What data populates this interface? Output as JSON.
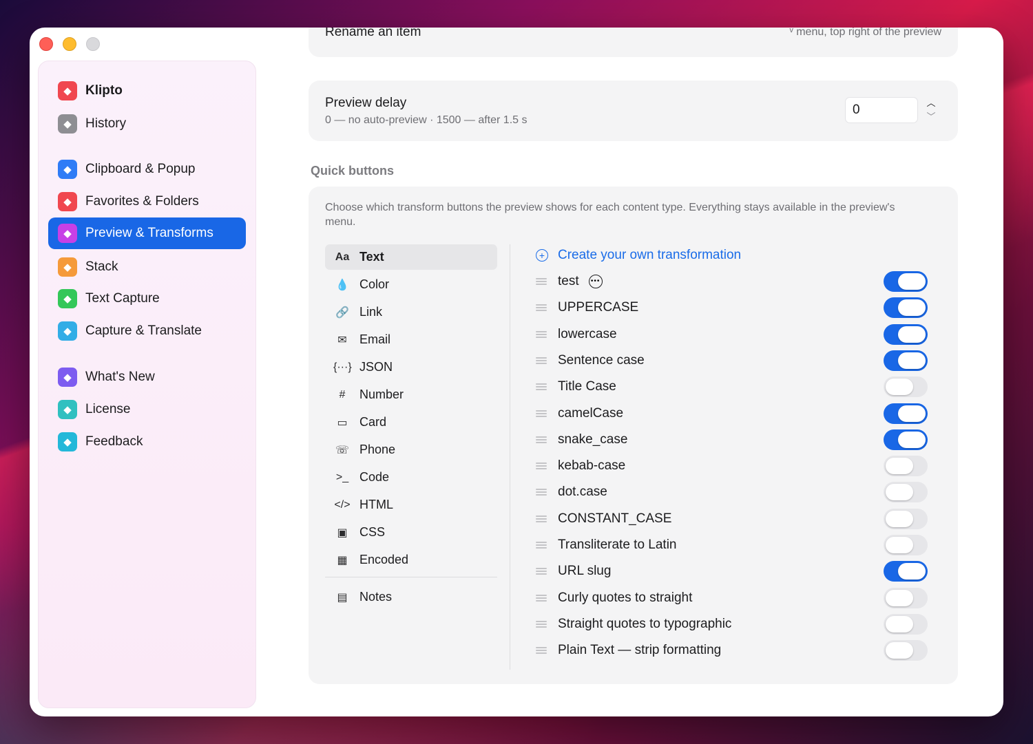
{
  "sidebar": {
    "items": [
      {
        "label": "Klipto",
        "icon": "cat-icon",
        "color": "#f0474f",
        "bold": true
      },
      {
        "label": "History",
        "icon": "clock-icon",
        "color": "#8e8e93"
      },
      {
        "label": "Clipboard & Popup",
        "icon": "clipboard-icon",
        "color": "#2f7cf6"
      },
      {
        "label": "Favorites & Folders",
        "icon": "heart-icon",
        "color": "#f0474f"
      },
      {
        "label": "Preview & Transforms",
        "icon": "preview-icon",
        "color": "#c740e6",
        "active": true
      },
      {
        "label": "Stack",
        "icon": "stack-icon",
        "color": "#f59a3a"
      },
      {
        "label": "Text Capture",
        "icon": "text-scan-icon",
        "color": "#34c759"
      },
      {
        "label": "Capture & Translate",
        "icon": "translate-icon",
        "color": "#32ade6"
      },
      {
        "label": "What's New",
        "icon": "sparkle-icon",
        "color": "#7d5cf0"
      },
      {
        "label": "License",
        "icon": "badge-check-icon",
        "color": "#30c0c0"
      },
      {
        "label": "Feedback",
        "icon": "paper-plane-icon",
        "color": "#23b8d9"
      }
    ]
  },
  "rename": {
    "title": "Rename an item",
    "note": "ᵛ menu, top right of the preview"
  },
  "delay": {
    "title": "Preview delay",
    "subtitle": "0 — no auto-preview · 1500 — after 1.5 s",
    "value": "0"
  },
  "quick": {
    "section_label": "Quick buttons",
    "description": "Choose which transform buttons the preview shows for each content type. Everything stays available in the preview's menu.",
    "types": [
      {
        "label": "Text",
        "glyph": "Aa",
        "icon": "text-icon",
        "selected": true
      },
      {
        "label": "Color",
        "glyph": "💧",
        "icon": "drop-icon"
      },
      {
        "label": "Link",
        "glyph": "🔗",
        "icon": "link-icon"
      },
      {
        "label": "Email",
        "glyph": "✉",
        "icon": "envelope-icon"
      },
      {
        "label": "JSON",
        "glyph": "{···}",
        "icon": "braces-icon"
      },
      {
        "label": "Number",
        "glyph": "#",
        "icon": "hash-icon"
      },
      {
        "label": "Card",
        "glyph": "▭",
        "icon": "credit-card-icon"
      },
      {
        "label": "Phone",
        "glyph": "☏",
        "icon": "phone-icon"
      },
      {
        "label": "Code",
        "glyph": ">_",
        "icon": "terminal-icon"
      },
      {
        "label": "HTML",
        "glyph": "</>",
        "icon": "angle-brackets-icon"
      },
      {
        "label": "CSS",
        "glyph": "▣",
        "icon": "css-icon"
      },
      {
        "label": "Encoded",
        "glyph": "▦",
        "icon": "qr-code-icon"
      }
    ],
    "notes": {
      "label": "Notes",
      "glyph": "▤",
      "icon": "document-icon"
    },
    "create_label": "Create your own transformation",
    "transforms": [
      {
        "label": "test",
        "on": true,
        "more": true
      },
      {
        "label": "UPPERCASE",
        "on": true
      },
      {
        "label": "lowercase",
        "on": true
      },
      {
        "label": "Sentence case",
        "on": true
      },
      {
        "label": "Title Case",
        "on": false
      },
      {
        "label": "camelCase",
        "on": true
      },
      {
        "label": "snake_case",
        "on": true
      },
      {
        "label": "kebab-case",
        "on": false
      },
      {
        "label": "dot.case",
        "on": false
      },
      {
        "label": "CONSTANT_CASE",
        "on": false
      },
      {
        "label": "Transliterate to Latin",
        "on": false
      },
      {
        "label": "URL slug",
        "on": true
      },
      {
        "label": "Curly quotes to straight",
        "on": false
      },
      {
        "label": "Straight quotes to typographic",
        "on": false
      },
      {
        "label": "Plain Text — strip formatting",
        "on": false
      }
    ]
  }
}
